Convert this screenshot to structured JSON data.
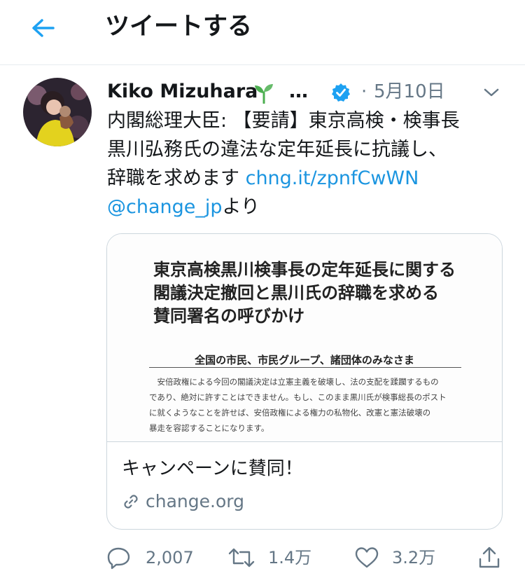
{
  "header": {
    "title": "ツイートする"
  },
  "tweet": {
    "author_name": "Kiko Mizuhara",
    "name_suffix": "…",
    "dot": "·",
    "date": "5月10日",
    "text_lines": [
      "内閣総理大臣: 【要請】東京高検・検事長",
      "黒川弘務氏の違法な定年延長に抗議し、",
      "辞職を求めます "
    ],
    "link_url": "chng.it/zpnfCwWN",
    "mention": "@change_jp",
    "mention_suffix": "より"
  },
  "card": {
    "image": {
      "title_lines": [
        "東京高検黒川検事長の定年延長に関する",
        "閣議決定撤回と黒川氏の辞職を求める",
        "賛同署名の呼びかけ"
      ],
      "subheading": "全国の市民、市民グループ、諸団体のみなさま",
      "body_lines": [
        "　安倍政権による今回の閣議決定は立憲主義を破壊し、法の支配を蹂躙するもの",
        "であり、絶対に許すことはできません。もし、このまま黒川氏が検事総長のポスト",
        "に就くようなことを許せば、安倍政権による権力の私物化、改憲と憲法破壊の",
        "暴走を容認することになります。"
      ]
    },
    "title": "キャンペーンに賛同！",
    "domain": "change.org"
  },
  "actions": {
    "replies": "2,007",
    "retweets": "1.4万",
    "likes": "3.2万"
  },
  "colors": {
    "accent": "#1da1f2",
    "link": "#1b95e0",
    "secondary_text": "#657786",
    "border": "#e6ecf0",
    "sprout": "#4caf50"
  },
  "icons": [
    "back-arrow-icon",
    "sprout-icon",
    "verified-badge-icon",
    "chevron-down-icon",
    "link-icon",
    "reply-icon",
    "retweet-icon",
    "like-icon",
    "share-icon"
  ]
}
